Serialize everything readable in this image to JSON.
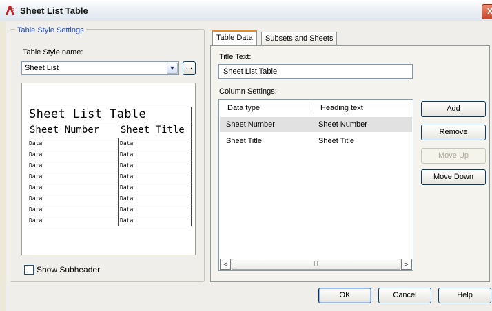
{
  "window": {
    "title": "Sheet List Table",
    "close_glyph": "X",
    "app_icon": "autocad-icon"
  },
  "left_panel": {
    "group_title": "Table Style Settings",
    "style_name_label": "Table Style name:",
    "style_name_value": "Sheet List",
    "browse_button": "...",
    "preview": {
      "title": "Sheet List Table",
      "headers": [
        "Sheet Number",
        "Sheet Title"
      ],
      "rows": [
        [
          "Data",
          "Data"
        ],
        [
          "Data",
          "Data"
        ],
        [
          "Data",
          "Data"
        ],
        [
          "Data",
          "Data"
        ],
        [
          "Data",
          "Data"
        ],
        [
          "Data",
          "Data"
        ],
        [
          "Data",
          "Data"
        ],
        [
          "Data",
          "Data"
        ]
      ]
    },
    "show_subheader_label": "Show Subheader",
    "show_subheader_checked": false
  },
  "tabs": [
    "Table Data",
    "Subsets and Sheets"
  ],
  "active_tab": "Table Data",
  "table_data": {
    "title_text_label": "Title Text:",
    "title_text_value": "Sheet List Table",
    "column_settings_label": "Column Settings:",
    "columns": [
      "Data type",
      "Heading text"
    ],
    "rows": [
      {
        "data_type": "Sheet Number",
        "heading": "Sheet Number",
        "selected": true
      },
      {
        "data_type": "Sheet Title",
        "heading": "Sheet Title",
        "selected": false
      }
    ],
    "scroll_left": "<",
    "scroll_right": ">",
    "scroll_grip": "III"
  },
  "side_buttons": {
    "add": "Add",
    "remove": "Remove",
    "move_up": "Move Up",
    "move_down": "Move Down"
  },
  "footer_buttons": {
    "ok": "OK",
    "cancel": "Cancel",
    "help": "Help"
  }
}
